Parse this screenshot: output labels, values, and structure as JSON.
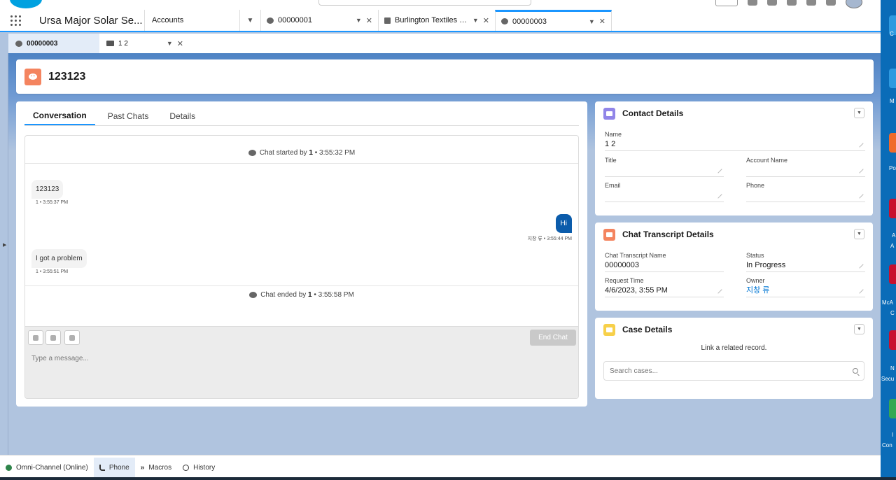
{
  "app": {
    "name": "Ursa Major Solar Se...",
    "nav_item": "Accounts"
  },
  "workspace_tabs": [
    {
      "label": "00000001",
      "type": "chat"
    },
    {
      "label": "Burlington Textiles C...",
      "type": "account"
    },
    {
      "label": "00000003",
      "type": "chat",
      "active": true
    }
  ],
  "subtabs": [
    {
      "label": "00000003",
      "active": true
    },
    {
      "label": "1 2"
    }
  ],
  "record": {
    "title": "123123"
  },
  "conversation": {
    "tabs": [
      "Conversation",
      "Past Chats",
      "Details"
    ],
    "started": {
      "prefix": "Chat started by ",
      "agent": "1",
      "time": " • 3:55:32 PM"
    },
    "ended": {
      "prefix": "Chat ended by ",
      "agent": "1",
      "time": " • 3:55:58 PM"
    },
    "messages": [
      {
        "dir": "in",
        "text": "123123",
        "meta": "1 • 3:55:37 PM"
      },
      {
        "dir": "out",
        "text": "Hi",
        "meta": "지창 류 • 3:55:44 PM"
      },
      {
        "dir": "in",
        "text": "I got a problem",
        "meta": "1 • 3:55:51 PM"
      }
    ],
    "end_chat_label": "End Chat",
    "input_placeholder": "Type a message..."
  },
  "contact_details": {
    "title": "Contact Details",
    "fields": {
      "name_label": "Name",
      "name_value": "1 2",
      "title_label": "Title",
      "title_value": "",
      "account_label": "Account Name",
      "account_value": "",
      "email_label": "Email",
      "email_value": "",
      "phone_label": "Phone",
      "phone_value": ""
    }
  },
  "transcript_details": {
    "title": "Chat Transcript Details",
    "fields": {
      "name_label": "Chat Transcript Name",
      "name_value": "00000003",
      "status_label": "Status",
      "status_value": "In Progress",
      "request_label": "Request Time",
      "request_value": "4/6/2023, 3:55 PM",
      "owner_label": "Owner",
      "owner_value": "지창 류"
    }
  },
  "case_details": {
    "title": "Case Details",
    "link_text": "Link a related record.",
    "search_placeholder": "Search cases..."
  },
  "utility_bar": [
    {
      "label": "Omni-Channel (Online)",
      "icon": "status-online-icon"
    },
    {
      "label": "Phone",
      "icon": "phone-icon",
      "active": true
    },
    {
      "label": "Macros",
      "icon": "macros-icon"
    },
    {
      "label": "History",
      "icon": "history-icon"
    }
  ],
  "desktop_labels": [
    "C",
    "M",
    "Po",
    "A",
    "A",
    "McA",
    "C",
    "N",
    "Secu",
    "I",
    "Con"
  ],
  "colors": {
    "brand_blue": "#1b96ff",
    "chat_orange": "#f4845f",
    "contact_purple": "#9185e8",
    "case_yellow": "#f7d04a",
    "outbound_bubble": "#0b5cab",
    "online_green": "#2e844a"
  }
}
